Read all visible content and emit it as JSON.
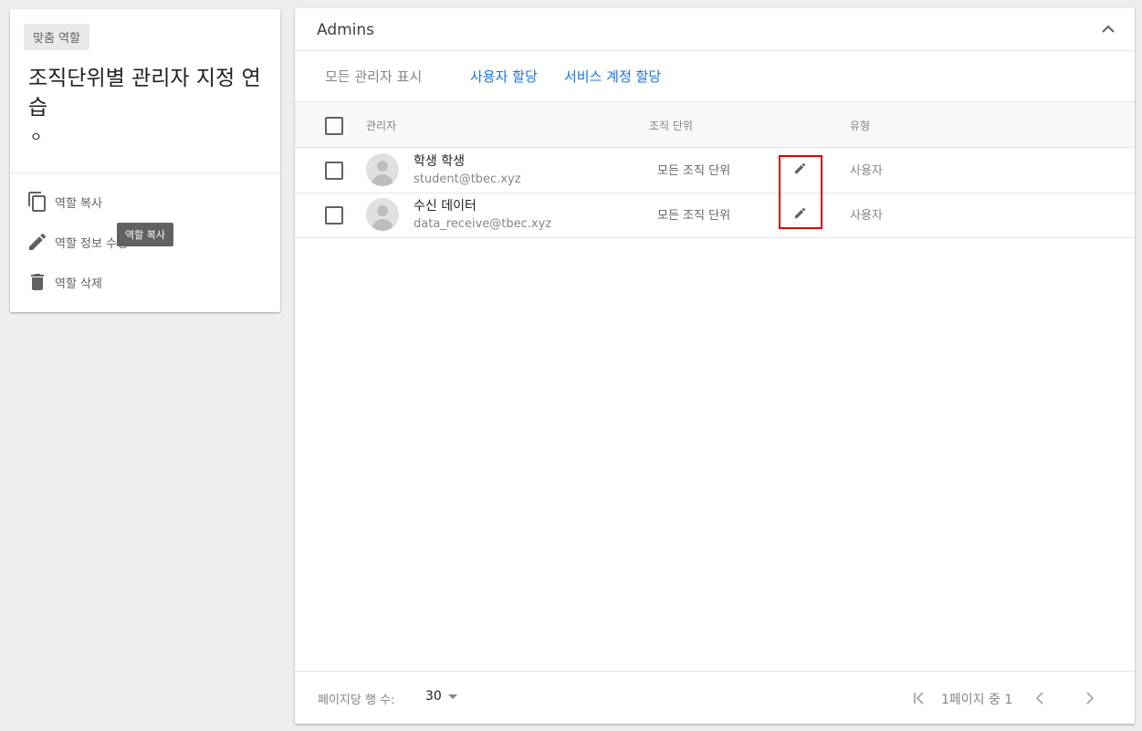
{
  "left_panel": {
    "chip": "맞춤 역할",
    "title": "조직단위별 관리자 지정 연습",
    "subtitle": "ㅇ",
    "actions": [
      {
        "label": "역할 복사",
        "icon": "copy-icon"
      },
      {
        "label": "역할 정보 수정",
        "icon": "pencil-icon"
      },
      {
        "label": "역할 삭제",
        "icon": "trash-icon"
      }
    ],
    "tooltip": "역할 복사"
  },
  "admins": {
    "title": "Admins",
    "filters": {
      "all": "모든 관리자 표시",
      "assign_user": "사용자 할당",
      "assign_service": "서비스 계정 할당"
    },
    "columns": {
      "admin": "관리자",
      "org_unit": "조직 단위",
      "type": "유형"
    },
    "rows": [
      {
        "name": "학생 학생",
        "email": "student@tbec.xyz",
        "org_unit": "모든 조직 단위",
        "type": "사용자"
      },
      {
        "name": "수신 데이터",
        "email": "data_receive@tbec.xyz",
        "org_unit": "모든 조직 단위",
        "type": "사용자"
      }
    ],
    "footer": {
      "rows_per_page_label": "페이지당 행 수:",
      "rows_per_page": "30",
      "page_info": "1페이지 중 1"
    }
  },
  "colors": {
    "link": "#1a73e8",
    "highlight": "#e00000"
  }
}
